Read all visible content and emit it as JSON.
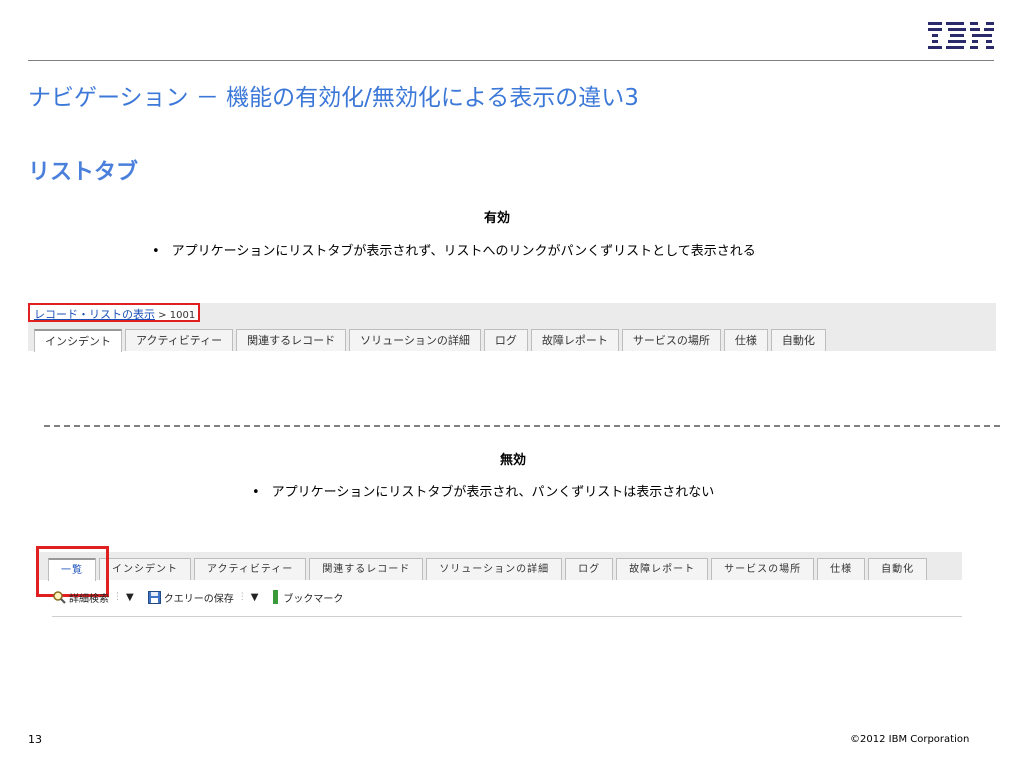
{
  "slide": {
    "title": "ナビゲーション － 機能の有効化/無効化による表示の違い3",
    "subtitle": "リストタブ",
    "page_number": "13",
    "copyright": "©2012 IBM Corporation",
    "logo_text": "IBM"
  },
  "enabled": {
    "heading": "有効",
    "bullet": "アプリケーションにリストタブが表示されず、リストへのリンクがパンくずリストとして表示される",
    "breadcrumb_link": "レコード・リストの表示",
    "breadcrumb_rest": " > 1001",
    "tabs": [
      "インシデント",
      "アクティビティー",
      "関連するレコード",
      "ソリューションの詳細",
      "ログ",
      "故障レポート",
      "サービスの場所",
      "仕様",
      "自動化"
    ]
  },
  "disabled": {
    "heading": "無効",
    "bullet": "アプリケーションにリストタブが表示され、パンくずリストは表示されない",
    "tabs": [
      "一覧",
      "インシデント",
      "アクティビティー",
      "関連するレコード",
      "ソリューションの詳細",
      "ログ",
      "故障レポート",
      "サービスの場所",
      "仕様",
      "自動化"
    ],
    "toolbar": {
      "advanced_search": "詳細検索",
      "save_query": "クエリーの保存",
      "bookmarks": "ブックマーク"
    }
  },
  "colors": {
    "accent": "#3c78d8",
    "highlight": "#e02020"
  }
}
